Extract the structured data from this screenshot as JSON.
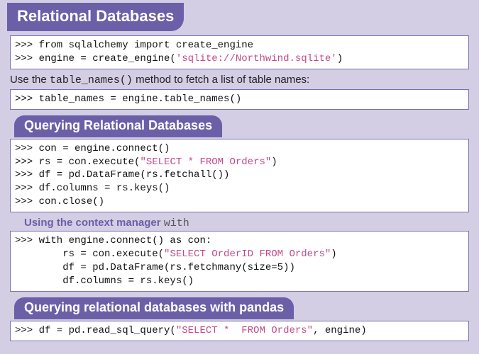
{
  "header": "Relational Databases",
  "block1": {
    "line1a": ">>> from sqlalchemy import create_engine",
    "line2a": ">>> engine = create_engine(",
    "line2b": "'sqlite://Northwind.sqlite'",
    "line2c": ")"
  },
  "caption1a": "Use the ",
  "caption1b": "table_names()",
  "caption1c": " method to fetch a list of table names:",
  "block2": {
    "line1": ">>> table_names = engine.table_names()"
  },
  "sub1": "Querying Relational Databases",
  "block3": {
    "line1": ">>> con = engine.connect()",
    "line2a": ">>> rs = con.execute(",
    "line2b": "\"SELECT * FROM Orders\"",
    "line2c": ")",
    "line3": ">>> df = pd.DataFrame(rs.fetchall())",
    "line4": ">>> df.columns = rs.keys()",
    "line5": ">>> con.close()"
  },
  "subcap_a": "Using the context manager ",
  "subcap_b": "with",
  "block4": {
    "line1": ">>> with engine.connect() as con:",
    "line2a": "        rs = con.execute(",
    "line2b": "\"SELECT OrderID FROM Orders\"",
    "line2c": ")",
    "line3": "        df = pd.DataFrame(rs.fetchmany(size=5))",
    "line4": "        df.columns = rs.keys()"
  },
  "sub2": "Querying relational databases with pandas",
  "block5": {
    "line1a": ">>> df = pd.read_sql_query(",
    "line1b": "\"SELECT *  FROM Orders\"",
    "line1c": ", engine)"
  }
}
